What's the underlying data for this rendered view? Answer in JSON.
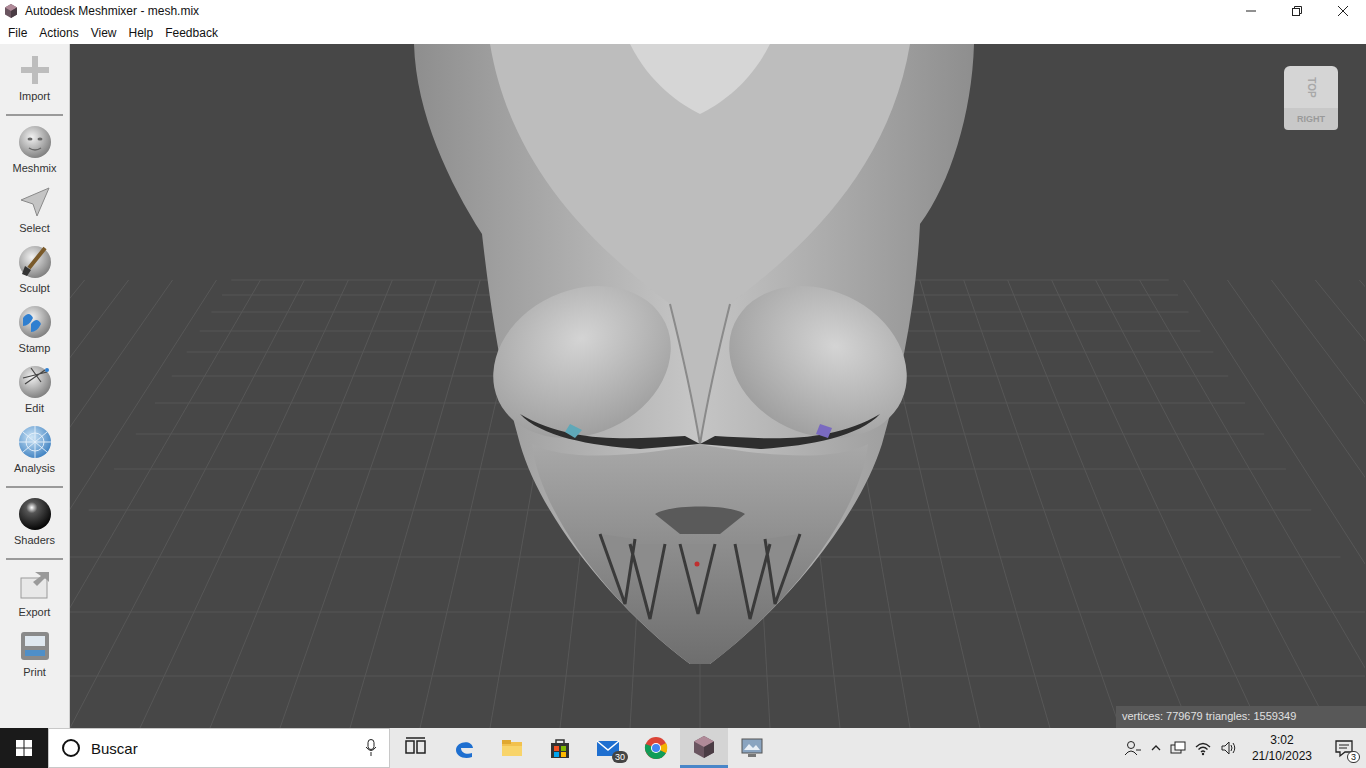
{
  "window": {
    "title": "Autodesk Meshmixer - mesh.mix"
  },
  "menu": [
    "File",
    "Actions",
    "View",
    "Help",
    "Feedback"
  ],
  "toolbar": {
    "groups": [
      [
        {
          "label": "Import"
        }
      ],
      [
        {
          "label": "Meshmix"
        },
        {
          "label": "Select"
        },
        {
          "label": "Sculpt"
        },
        {
          "label": "Stamp"
        },
        {
          "label": "Edit"
        },
        {
          "label": "Analysis"
        }
      ],
      [
        {
          "label": "Shaders"
        }
      ],
      [
        {
          "label": "Export"
        },
        {
          "label": "Print"
        }
      ]
    ]
  },
  "view_cube": {
    "top": "TOP",
    "front": "RIGHT"
  },
  "status_bar": {
    "text": "vertices: 779679 triangles: 1559349"
  },
  "taskbar": {
    "search": {
      "placeholder": "Buscar"
    },
    "apps": [
      {
        "active": false
      },
      {
        "active": false
      },
      {
        "active": false
      },
      {
        "active": false
      },
      {
        "active": false,
        "badge": "30"
      },
      {
        "active": false
      },
      {
        "active": true
      },
      {
        "active": false
      }
    ],
    "clock": {
      "time": "3:02",
      "date": "21/10/2023"
    },
    "notifications": {
      "badge": "3"
    }
  }
}
